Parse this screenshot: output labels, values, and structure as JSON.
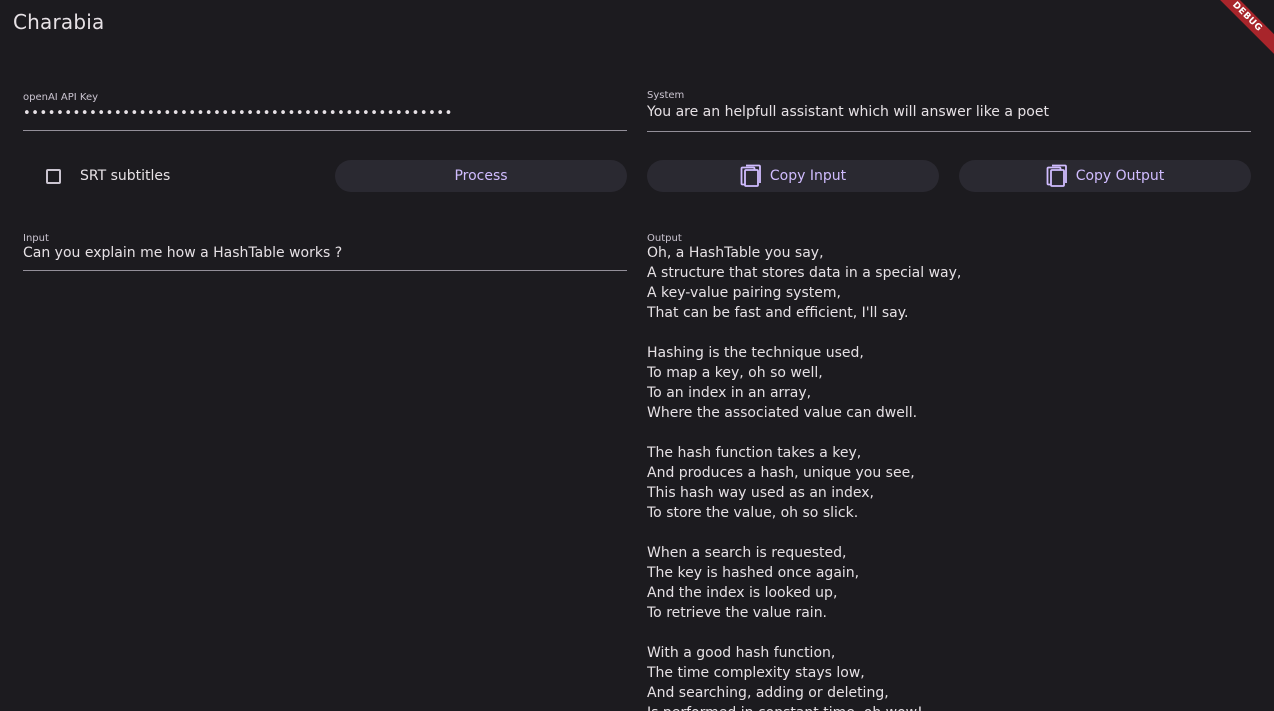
{
  "app": {
    "title": "Charabia",
    "debug_banner": "DEBUG"
  },
  "api_key": {
    "label": "openAI API Key",
    "value": "••••••••••••••••••••••••••••••••••••••••••••••••••••"
  },
  "system": {
    "label": "System",
    "value": "You are an helpfull assistant which will answer like a poet"
  },
  "controls": {
    "srt_label": "SRT subtitles",
    "srt_checked": false,
    "process_label": "Process",
    "copy_input_label": "Copy Input",
    "copy_input_icon": "copy-icon",
    "copy_output_label": "Copy Output",
    "copy_output_icon": "copy-icon"
  },
  "input": {
    "label": "Input",
    "value": "Can you explain me how a HashTable works ?"
  },
  "output": {
    "label": "Output",
    "text": "Oh, a HashTable you say,\nA structure that stores data in a special way,\nA key-value pairing system,\nThat can be fast and efficient, I'll say.\n\nHashing is the technique used,\nTo map a key, oh so well,\nTo an index in an array,\nWhere the associated value can dwell.\n\nThe hash function takes a key,\nAnd produces a hash, unique you see,\nThis hash way used as an index,\nTo store the value, oh so slick.\n\nWhen a search is requested,\nThe key is hashed once again,\nAnd the index is looked up,\nTo retrieve the value rain.\n\nWith a good hash function,\nThe time complexity stays low,\nAnd searching, adding or deleting,\nIs performed in constant time, oh wow!"
  },
  "colors": {
    "background": "#1c1b1f",
    "accent": "#d0bcff",
    "button_bg": "#2a2931",
    "debug": "#a8252b"
  }
}
